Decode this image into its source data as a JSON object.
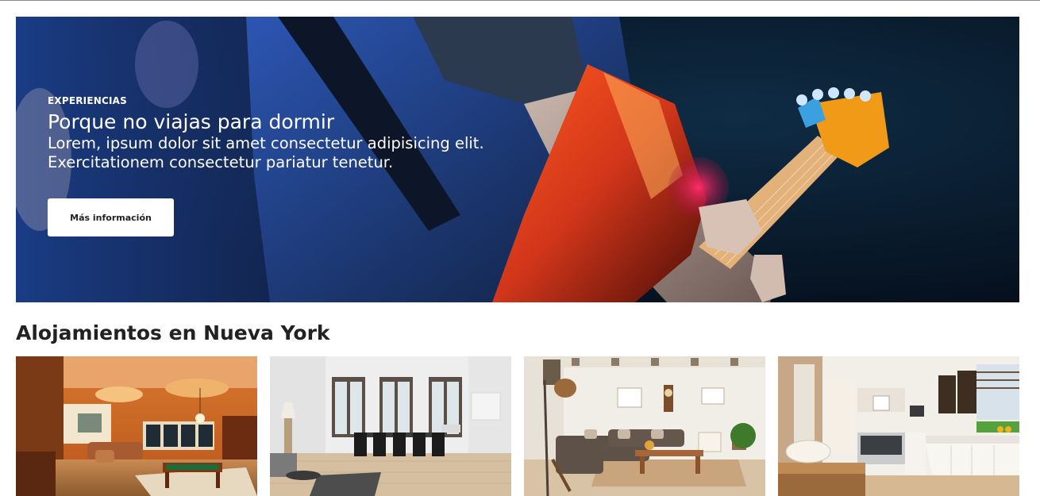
{
  "hero": {
    "eyebrow": "EXPERIENCIAS",
    "title": "Porque no viajas para dormir",
    "description_line1": "Lorem, ipsum dolor sit amet consectetur adipisicing elit.",
    "description_line2": "Exercitationem consectetur pariatur tenetur.",
    "button_label": "Más información",
    "image": "guitarist-performing-photo"
  },
  "section": {
    "title": "Alojamientos en Nueva York"
  },
  "listings": [
    {
      "image": "game-room-with-pool-table-photo"
    },
    {
      "image": "bright-dining-room-photo"
    },
    {
      "image": "living-room-with-sofa-photo"
    },
    {
      "image": "modern-kitchen-photo"
    }
  ],
  "colors": {
    "hero_background": "#0a1a2e",
    "text_primary": "#222222",
    "button_background": "#ffffff"
  }
}
